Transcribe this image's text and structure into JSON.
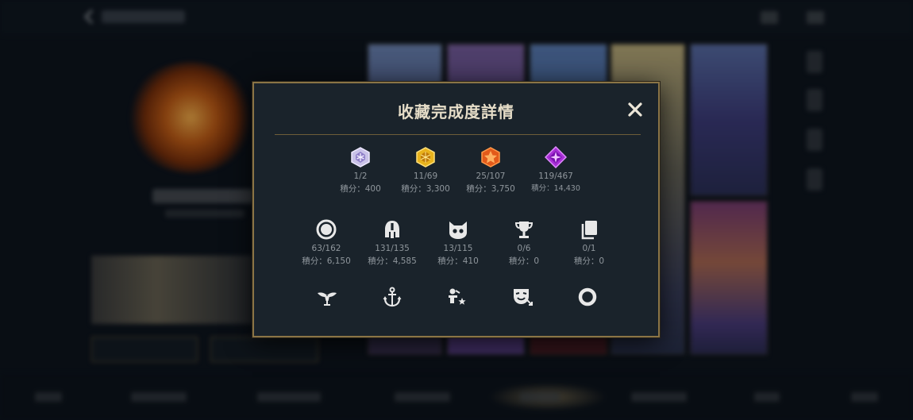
{
  "modal": {
    "title": "收藏完成度詳情",
    "close_glyph": "✕"
  },
  "points_label": "積分：",
  "row1": [
    {
      "icon": "crystal-gem-icon",
      "count": "1/2",
      "points": "400"
    },
    {
      "icon": "gold-gem-icon",
      "count": "11/69",
      "points": "3,300"
    },
    {
      "icon": "orange-gem-icon",
      "count": "25/107",
      "points": "3,750"
    },
    {
      "icon": "purple-gem-icon",
      "count": "119/467",
      "points": "14,430"
    }
  ],
  "row2": [
    {
      "icon": "summoner-icon-circle-icon",
      "count": "63/162",
      "points": "6,150"
    },
    {
      "icon": "champion-helmet-icon",
      "count": "131/135",
      "points": "4,585"
    },
    {
      "icon": "little-legend-icon",
      "count": "13/115",
      "points": "410"
    },
    {
      "icon": "trophy-icon",
      "count": "0/6",
      "points": "0"
    },
    {
      "icon": "cards-icon",
      "count": "0/1",
      "points": "0"
    }
  ],
  "row3": [
    {
      "icon": "ward-wings-icon"
    },
    {
      "icon": "anchor-icon"
    },
    {
      "icon": "emote-person-icon"
    },
    {
      "icon": "theater-mask-icon"
    },
    {
      "icon": "ring-icon"
    }
  ],
  "colors": {
    "accent_gold": "#8a7446",
    "title_text": "#e6ddc8",
    "stat_text": "#8f969c",
    "panel_bg": "#1a232b"
  }
}
